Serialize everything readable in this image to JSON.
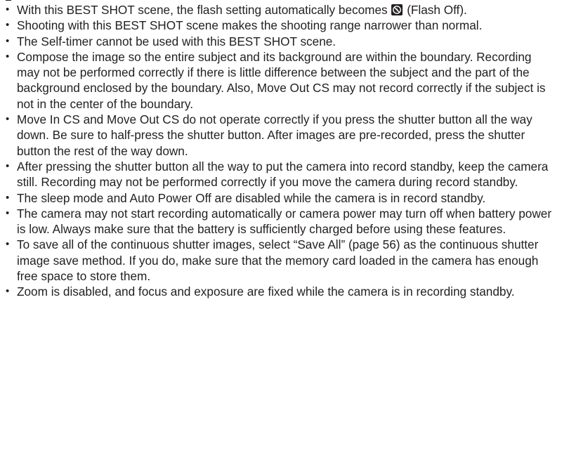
{
  "bullets": [
    {
      "before_icon": "With this BEST SHOT scene, the flash setting automatically becomes ",
      "icon": "flash-off-icon",
      "after_icon": " (Flash Off)."
    },
    {
      "text": "Shooting with this BEST SHOT scene makes the shooting range narrower than normal."
    },
    {
      "text": "The Self-timer cannot be used with this BEST SHOT scene."
    },
    {
      "text": "Compose the image so the entire subject and its background are within the boundary. Recording may not be performed correctly if there is little difference between the subject and the part of the background enclosed by the boundary. Also, Move Out CS may not record correctly if the subject is not in the center of the boundary."
    },
    {
      "text": "Move In CS and Move Out CS do not operate correctly if you press the shutter button all the way down. Be sure to half-press the shutter button. After images are pre-recorded, press the shutter button the rest of the way down."
    },
    {
      "text": "After pressing the shutter button all the way to put the camera into record standby, keep the camera still. Recording may not be performed correctly if you move the camera during record standby."
    },
    {
      "text": "The sleep mode and Auto Power Off are disabled while the camera is in record standby."
    },
    {
      "text": "The camera may not start recording automatically or camera power may turn off when battery power is low. Always make sure that the battery is sufficiently charged before using these features."
    },
    {
      "text": "To save all of the continuous shutter images, select “Save All” (page 56) as the continuous shutter image save method. If you do, make sure that the memory card loaded in the camera has enough free space to store them."
    },
    {
      "text": "Zoom is disabled, and focus and exposure are fixed while the camera is in recording standby."
    }
  ]
}
